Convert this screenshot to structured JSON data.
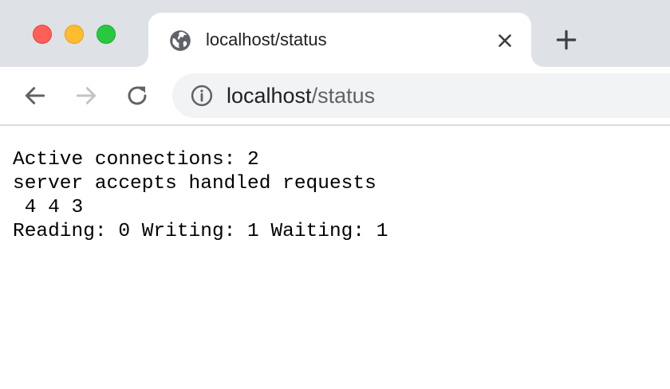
{
  "window": {
    "traffic_lights": [
      "close",
      "minimize",
      "zoom"
    ]
  },
  "tab": {
    "title": "localhost/status",
    "favicon": "globe-icon",
    "close_icon": "close-icon"
  },
  "new_tab_icon": "plus-icon",
  "toolbar": {
    "back_icon": "back-arrow-icon",
    "forward_icon": "forward-arrow-icon",
    "reload_icon": "reload-icon",
    "site_info_icon": "info-icon",
    "url_host": "localhost",
    "url_path": "/status"
  },
  "page": {
    "lines": [
      "Active connections: 2",
      "server accepts handled requests",
      " 4 4 3",
      "Reading: 0 Writing: 1 Waiting: 1"
    ]
  },
  "colors": {
    "tab_strip": "#dee1e6",
    "omnibox": "#f1f3f4",
    "close_light": "#fe5f57",
    "minimize_light": "#febc2e",
    "zoom_light": "#28c840"
  }
}
